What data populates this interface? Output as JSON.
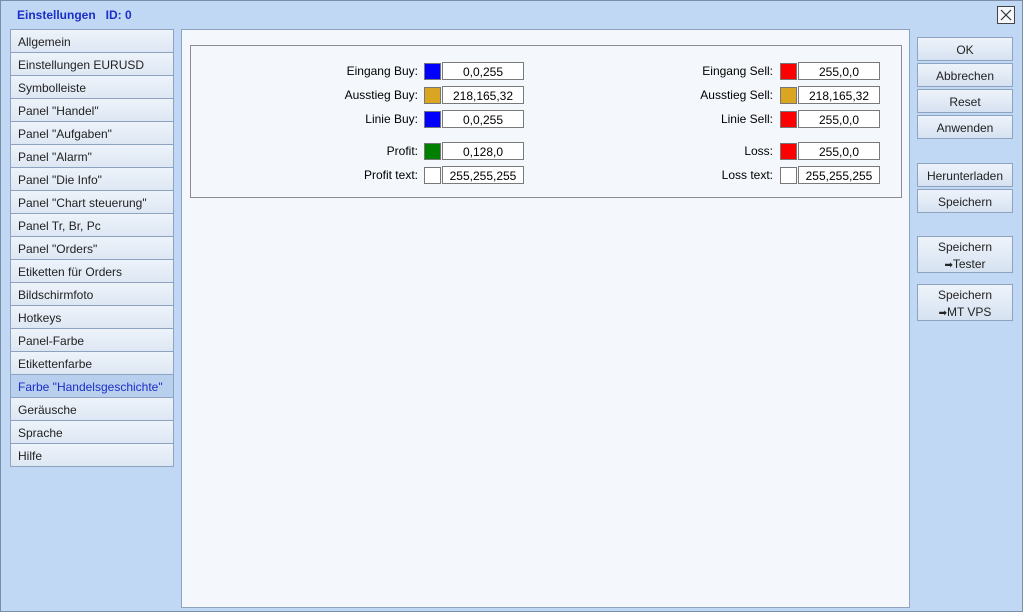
{
  "window": {
    "title": "Einstellungen   ID: 0"
  },
  "sidebar": {
    "items": [
      {
        "label": "Allgemein"
      },
      {
        "label": "Einstellungen EURUSD"
      },
      {
        "label": "Symbolleiste"
      },
      {
        "label": "Panel \"Handel\""
      },
      {
        "label": "Panel \"Aufgaben\""
      },
      {
        "label": "Panel \"Alarm\""
      },
      {
        "label": "Panel \"Die Info\""
      },
      {
        "label": "Panel \"Chart steuerung\""
      },
      {
        "label": "Panel Tr, Br, Pc"
      },
      {
        "label": "Panel \"Orders\""
      },
      {
        "label": "Etiketten für Orders"
      },
      {
        "label": "Bildschirmfoto"
      },
      {
        "label": "Hotkeys"
      },
      {
        "label": "Panel-Farbe"
      },
      {
        "label": "Etikettenfarbe"
      },
      {
        "label": "Farbe \"Handelsgeschichte\""
      },
      {
        "label": "Geräusche"
      },
      {
        "label": "Sprache"
      },
      {
        "label": "Hilfe"
      }
    ],
    "active_index": 15
  },
  "colors": {
    "eingang_buy": {
      "label": "Eingang Buy:",
      "value": "0,0,255",
      "swatch": "#0000ff"
    },
    "ausstieg_buy": {
      "label": "Ausstieg Buy:",
      "value": "218,165,32",
      "swatch": "#daa520"
    },
    "linie_buy": {
      "label": "Linie Buy:",
      "value": "0,0,255",
      "swatch": "#0000ff"
    },
    "profit": {
      "label": "Profit:",
      "value": "0,128,0",
      "swatch": "#008000"
    },
    "profit_text": {
      "label": "Profit text:",
      "value": "255,255,255",
      "swatch": "#ffffff"
    },
    "eingang_sell": {
      "label": "Eingang Sell:",
      "value": "255,0,0",
      "swatch": "#ff0000"
    },
    "ausstieg_sell": {
      "label": "Ausstieg Sell:",
      "value": "218,165,32",
      "swatch": "#daa520"
    },
    "linie_sell": {
      "label": "Linie Sell:",
      "value": "255,0,0",
      "swatch": "#ff0000"
    },
    "loss": {
      "label": "Loss:",
      "value": "255,0,0",
      "swatch": "#ff0000"
    },
    "loss_text": {
      "label": "Loss text:",
      "value": "255,255,255",
      "swatch": "#ffffff"
    }
  },
  "actions": {
    "ok": "OK",
    "abbrechen": "Abbrechen",
    "reset": "Reset",
    "anwenden": "Anwenden",
    "herunterladen": "Herunterladen",
    "speichern": "Speichern",
    "speichern_tester_line1": "Speichern",
    "speichern_tester_line2": "Tester",
    "speichern_vps_line1": "Speichern",
    "speichern_vps_line2": "MT VPS"
  },
  "theme": {
    "accent": "#1a2ec8",
    "window_bg": "#c1d8f5"
  }
}
